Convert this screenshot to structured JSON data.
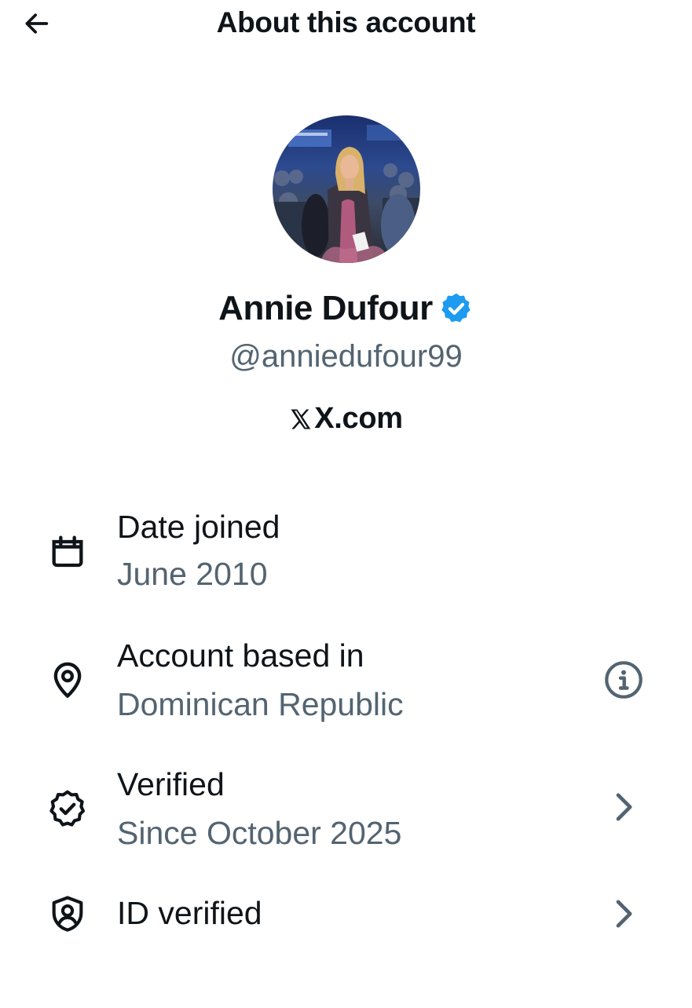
{
  "header": {
    "title": "About this account",
    "back_icon": "arrow-left-icon"
  },
  "profile": {
    "display_name": "Annie Dufour",
    "handle": "@anniedufour99",
    "verified_badge_color": "#1d9bf0",
    "source": "X.com",
    "source_icon": "x-logo-icon"
  },
  "details": [
    {
      "icon": "calendar-icon",
      "label": "Date joined",
      "value": "June 2010",
      "trailing": ""
    },
    {
      "icon": "location-pin-icon",
      "label": "Account based in",
      "value": "Dominican Republic",
      "trailing": "info-icon"
    },
    {
      "icon": "verified-check-icon",
      "label": "Verified",
      "value": "Since October 2025",
      "trailing": "chevron-right-icon"
    },
    {
      "icon": "shield-user-icon",
      "label": "ID verified",
      "value": "",
      "trailing": "chevron-right-icon"
    }
  ],
  "colors": {
    "text_primary": "#0f1419",
    "text_secondary": "#536471",
    "accent": "#1d9bf0"
  }
}
